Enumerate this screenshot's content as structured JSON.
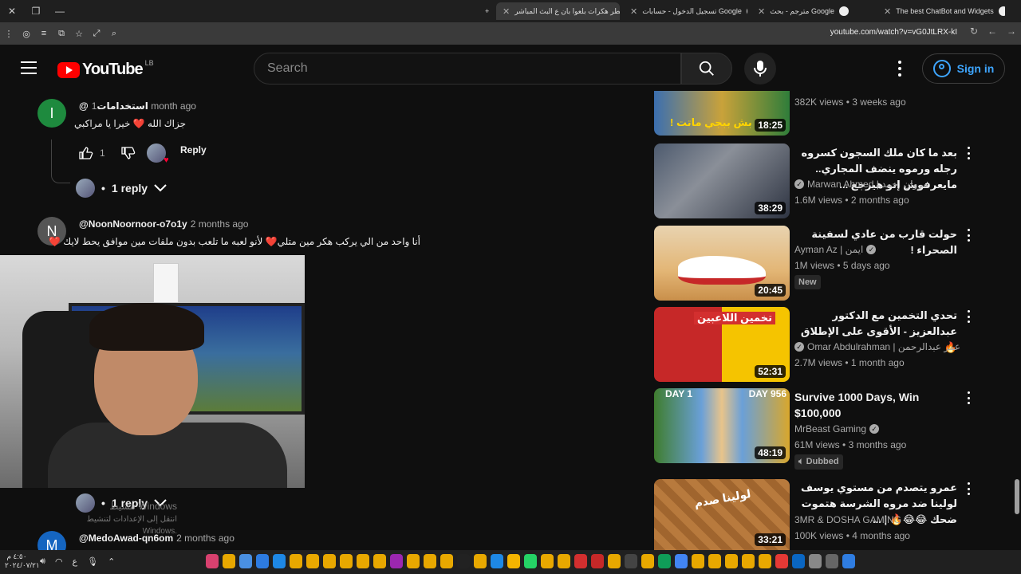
{
  "browser": {
    "tabs": [
      {
        "title": "أخطر هكرات بلعوا بان ع البث المباشر",
        "active": true
      },
      {
        "title": "تسجيل الدخول - حسابات Google",
        "active": false
      },
      {
        "title": "مترجم - بحث Google",
        "active": false
      },
      {
        "title": "The best ChatBot and Widgets",
        "active": false
      }
    ],
    "new_tab": "+",
    "url": "youtube.com/watch?v=vG0JtLRX-kI"
  },
  "header": {
    "logo_text": "YouTube",
    "country": "LB",
    "search_placeholder": "Search",
    "sign_in": "Sign in"
  },
  "comments": [
    {
      "avatar_letter": "I",
      "avatar_color": "#1e8a3e",
      "author": "@استخدامات",
      "time": "1 month ago",
      "text": "جزاك الله ❤️ خيرا يا مراكبي",
      "likes": "1",
      "reply_label": "Reply",
      "replies": "1 reply"
    },
    {
      "avatar_letter": "N",
      "avatar_color": "#555555",
      "author": "@NoonNoornoor-o7o1y",
      "time": "2 months ago",
      "text": "أنا واحد من الي يركب هكر مين متلي❤️ لأنو لعبه ما تلعب بدون ملفات مين موافق يحط لايك ❤️",
      "replies": "1 reply"
    },
    {
      "avatar_letter": "M",
      "avatar_color": "#1565c0",
      "author": "@MedoAwad-qn6om",
      "time": "2 months ago"
    }
  ],
  "windows_watermark": {
    "line1": "تنشيط Windows",
    "line2": "انتقل إلى الإعدادات لتنشيط Windows."
  },
  "sidebar": [
    {
      "title": "",
      "channel": "",
      "views": "382K views",
      "age": "3 weeks ago",
      "duration": "18:25",
      "thumb_text": "بش ببجي ماتت !"
    },
    {
      "title": "بعد ما كان ملك السجون كسروه رجله ورموه ينضف المجاري.. مايعرفوش إنو هيرجع ...",
      "channel": "Marwan Ahmed | مروان احمد",
      "verified": true,
      "views": "1.6M views",
      "age": "2 months ago",
      "duration": "38:29"
    },
    {
      "title": "حولت قارب من عادي لسفينة الصحراء !",
      "channel": "Ayman Az | ايمن",
      "verified": true,
      "views": "1M views",
      "age": "5 days ago",
      "duration": "20:45",
      "badge": "New"
    },
    {
      "title": "تحدي التخمين مع الدكتور عبدالعزيز - الأقوى على الإطلاق 🔥",
      "channel": "Omar Abdulrahman | عمر عبدالرحمن",
      "verified": true,
      "views": "2.7M views",
      "age": "1 month ago",
      "duration": "52:31",
      "thumb_text": "تخمين اللاعبين"
    },
    {
      "title": "Survive 1000 Days, Win $100,000",
      "channel": "MrBeast Gaming",
      "verified": true,
      "views": "61M views",
      "age": "3 months ago",
      "duration": "48:19",
      "badge": "Dubbed",
      "thumb_left": "DAY 1",
      "thumb_right": "DAY 956"
    },
    {
      "title": "عمرو يتصدم من مستوي يوسف لولينا ضد مروه الشرسة هتموت ضحك 😂😂🔥 | ...",
      "channel": "3MR & DOSHA GAMING",
      "verified": false,
      "views": "100K views",
      "age": "4 months ago",
      "duration": "33:21",
      "thumb_text": "لولينا صدم"
    }
  ],
  "taskbar": {
    "time": "٤:٥٠ م",
    "date": "٢٠٢٤/٠٧/٢١",
    "lang": "ع"
  }
}
